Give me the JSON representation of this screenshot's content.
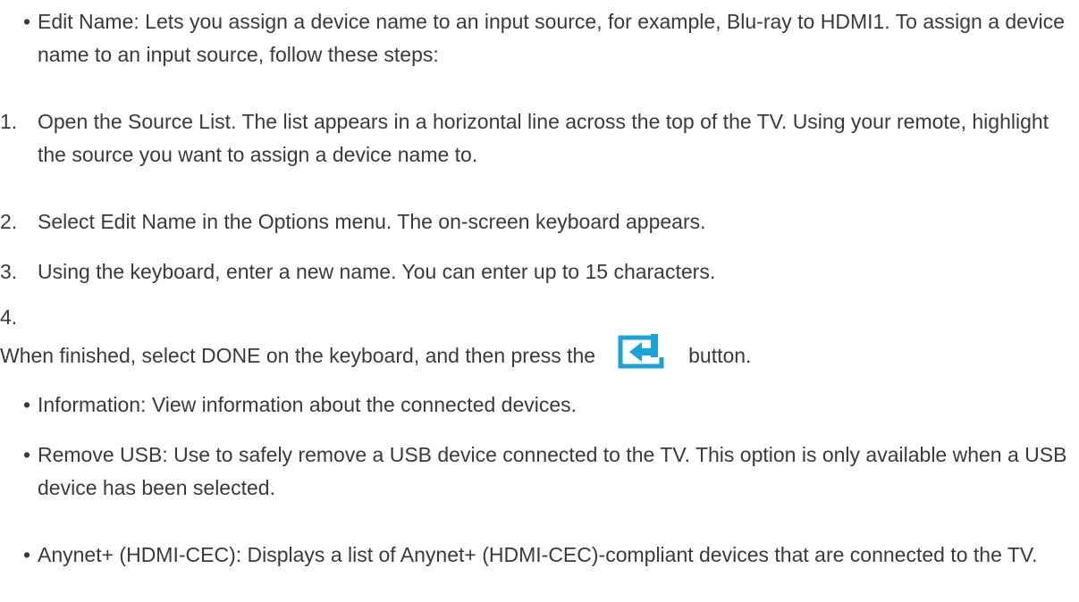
{
  "items": [
    {
      "marker": "•",
      "text": "Edit Name: Lets you assign a device name to an input source, for example, Blu-ray to HDMI1. To assign a device name to an input source, follow these steps:"
    },
    {
      "marker": "1.",
      "text": "Open the Source List. The list appears in a horizontal line across the top of the TV. Using your remote, highlight the source you want to assign a device name to."
    },
    {
      "marker": "2.",
      "text": "Select Edit Name in the Options menu. The on-screen keyboard appears."
    },
    {
      "marker": "3.",
      "text": "Using the keyboard, enter a new name. You can enter up to 15 characters."
    },
    {
      "marker": "4.",
      "text_before_icon": "When finished, select DONE on the keyboard, and then press the",
      "icon": "enter-key-icon",
      "text_after_icon": "button."
    },
    {
      "marker": "•",
      "text": "Information: View information about the connected devices."
    },
    {
      "marker": "•",
      "text": "Remove USB: Use to safely remove a USB device connected to the TV. This option is only available when a USB device has been selected."
    },
    {
      "marker": "•",
      "text": "Anynet+ (HDMI-CEC): Displays a list of Anynet+ (HDMI-CEC)-compliant devices that are connected to the TV."
    }
  ],
  "colors": {
    "text": "#3a3a3a",
    "icon": "#1aa3d6"
  }
}
